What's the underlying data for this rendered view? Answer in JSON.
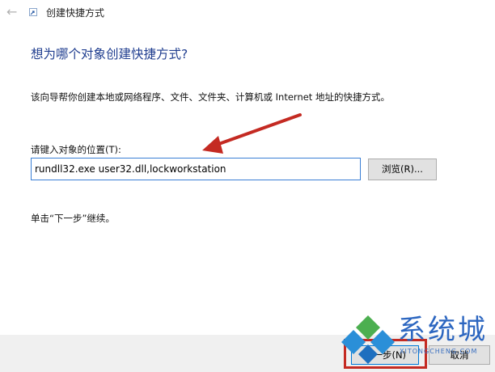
{
  "window": {
    "title": "创建快捷方式",
    "back_icon": "back-arrow-icon"
  },
  "main": {
    "heading": "想为哪个对象创建快捷方式?",
    "description": "该向导帮你创建本地或网络程序、文件、文件夹、计算机或 Internet 地址的快捷方式。",
    "field_label": "请键入对象的位置(T):",
    "target_value": "rundll32.exe user32.dll,lockworkstation",
    "browse_label": "浏览(R)...",
    "hint": "单击“下一步”继续。"
  },
  "footer": {
    "next_label": "下一步(N)",
    "cancel_label": "取消"
  },
  "watermark": {
    "text": "系统城",
    "url": "XITONGCHENG.COM"
  },
  "colors": {
    "heading": "#1f3d8f",
    "annotation_red": "#c42a22",
    "input_border": "#3a7fd5",
    "watermark_blue": "#2c66c0",
    "watermark_green": "#4caf50"
  }
}
